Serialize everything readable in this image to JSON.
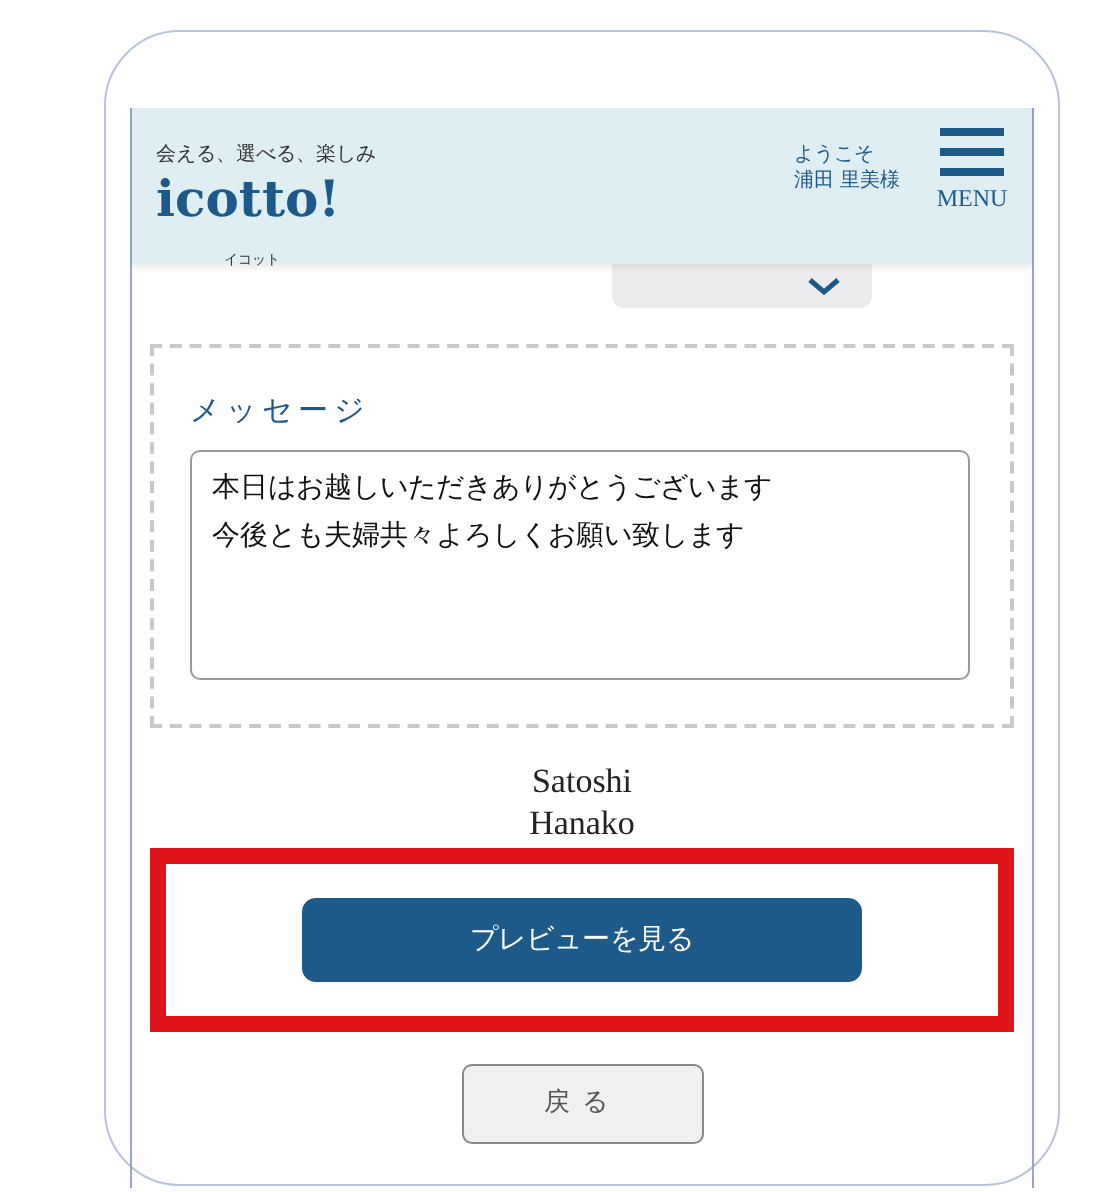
{
  "header": {
    "tagline": "会える、選べる、楽しみ",
    "logo": "icotto!",
    "logo_reading": "イコット",
    "welcome": "ようこそ",
    "user": "浦田 里美様",
    "menu_label": "MENU"
  },
  "message": {
    "label": "メッセージ",
    "lines": [
      "本日はお越しいただきありがとうございます",
      "今後とも夫婦共々よろしくお願い致します"
    ]
  },
  "signature": [
    "Satoshi",
    "Hanako"
  ],
  "preview_button": {
    "label": "プレビューを見る",
    "highlighted": true
  },
  "back_button": {
    "label": "戻る"
  }
}
